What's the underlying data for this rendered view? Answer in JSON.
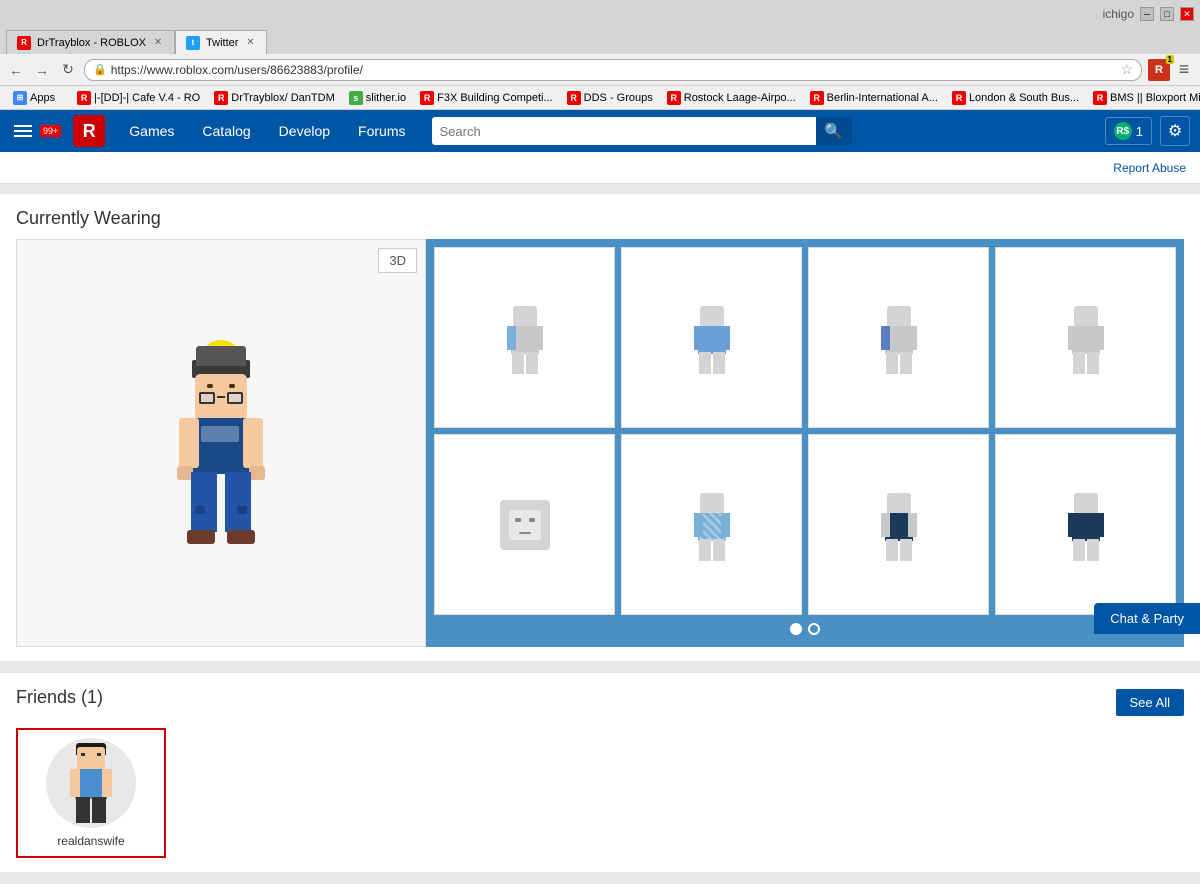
{
  "browser": {
    "tab_roblox_title": "DrTrayblox - ROBLOX",
    "tab_twitter_title": "Twitter",
    "address": "https://www.roblox.com/users/86623883/profile/",
    "user_label": "ichigo",
    "window_buttons": [
      "minimize",
      "maximize",
      "close"
    ]
  },
  "bookmarks": {
    "apps_label": "Apps",
    "items": [
      {
        "label": "R",
        "text": "|-[DD]-| Cafe V.4 - RO",
        "color": "#e00"
      },
      {
        "label": "R",
        "text": "DrTrayblox/ DanTDM",
        "color": "#e00"
      },
      {
        "label": "S",
        "text": "slither.io",
        "color": "#4a4"
      },
      {
        "label": "R",
        "text": "F3X Building Competi...",
        "color": "#e00"
      },
      {
        "label": "R",
        "text": "DDS - Groups",
        "color": "#e00"
      },
      {
        "label": "R",
        "text": "Rostock Laage-Airpo...",
        "color": "#e00"
      },
      {
        "label": "R",
        "text": "Berlin-International A...",
        "color": "#e00"
      },
      {
        "label": "R",
        "text": "London & South Bus...",
        "color": "#e00"
      },
      {
        "label": "R",
        "text": "BMS || Bloxport Midd...",
        "color": "#e00"
      }
    ]
  },
  "navbar": {
    "notification_count": "99+",
    "games": "Games",
    "catalog": "Catalog",
    "develop": "Develop",
    "forums": "Forums",
    "search_placeholder": "Search",
    "robux_count": "1",
    "settings_tooltip": "Settings"
  },
  "report_abuse": "Report Abuse",
  "currently_wearing": {
    "title": "Currently Wearing",
    "btn_3d": "3D",
    "items": [
      {
        "type": "shirt",
        "color1": "#c8c8c8",
        "color2": "#5a7fc0"
      },
      {
        "type": "shirt",
        "color1": "#c8c8c8",
        "color2": "#6a9ed8"
      },
      {
        "type": "shirt",
        "color1": "#c8c8c8",
        "color2": "#5a7fc0"
      },
      {
        "type": "shirt",
        "color1": "#c8c8c8",
        "color2": "#c8c8c8"
      },
      {
        "type": "head",
        "color1": "#c8c8c8",
        "color2": "#c8c8c8"
      },
      {
        "type": "shirt",
        "color1": "#c8c8c8",
        "color2": "#7ab0d8"
      },
      {
        "type": "shirt",
        "color1": "#c8c8c8",
        "color2": "#1a3a5c"
      },
      {
        "type": "shirt",
        "color1": "#1a3a5c",
        "color2": "#1a3a5c"
      }
    ],
    "pagination": [
      {
        "active": true
      },
      {
        "active": false
      }
    ]
  },
  "friends": {
    "title": "Friends",
    "count": "(1)",
    "see_all": "See All",
    "items": [
      {
        "name": "realdanswife",
        "selected": true
      }
    ]
  },
  "chat_btn": "Chat & Party"
}
